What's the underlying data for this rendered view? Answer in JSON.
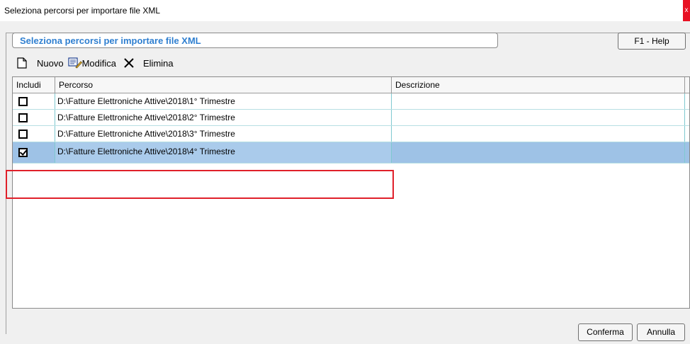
{
  "window": {
    "title": "Seleziona percorsi per importare file XML",
    "close_label": "x"
  },
  "group": {
    "title": "Seleziona percorsi per importare file XML",
    "help_label": "F1 - Help"
  },
  "toolbar": {
    "new_label": "Nuovo",
    "edit_label": "Modifica",
    "delete_label": "Elimina"
  },
  "grid": {
    "columns": [
      "Includi",
      "Percorso",
      "Descrizione"
    ],
    "rows": [
      {
        "included": false,
        "path": "D:\\Fatture Elettroniche Attive\\2018\\1° Trimestre",
        "description": ""
      },
      {
        "included": false,
        "path": "D:\\Fatture Elettroniche Attive\\2018\\2° Trimestre",
        "description": ""
      },
      {
        "included": false,
        "path": "D:\\Fatture Elettroniche Attive\\2018\\3° Trimestre",
        "description": ""
      },
      {
        "included": true,
        "path": "D:\\Fatture Elettroniche Attive\\2018\\4° Trimestre",
        "description": ""
      }
    ]
  },
  "footer": {
    "confirm_label": "Conferma",
    "cancel_label": "Annulla"
  },
  "colors": {
    "group_title": "#2f7fd0",
    "selected_row": "#9ec2e6",
    "highlight_border": "#e0202a"
  }
}
